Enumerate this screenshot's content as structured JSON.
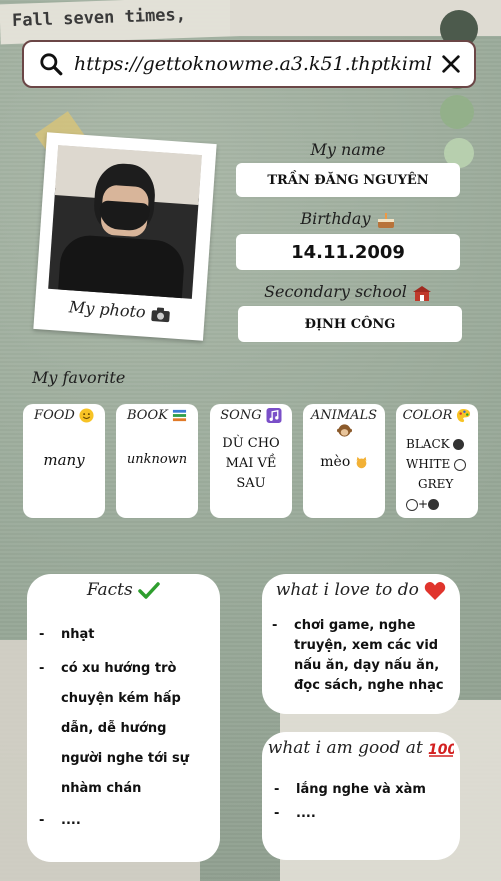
{
  "header": {
    "deco_text": "Fall seven times,",
    "url": "https://gettoknowme.a3.k51.thptkimlien"
  },
  "profile": {
    "photo_caption": "My photo",
    "name_label": "My name",
    "name_value": "TRẦN ĐĂNG NGUYÊN",
    "birthday_label": "Birthday",
    "birthday_value": "14.11.2009",
    "school_label": "Secondary school",
    "school_value": "ĐỊNH CÔNG"
  },
  "favorites": {
    "title": "My favorite",
    "cards": [
      {
        "head": "FOOD",
        "icon": "smile-icon",
        "value": "many"
      },
      {
        "head": "BOOK",
        "icon": "books-icon",
        "value": "unknown"
      },
      {
        "head": "SONG",
        "icon": "music-icon",
        "value": "DÙ CHO MAI VỀ SAU"
      },
      {
        "head": "ANIMALS",
        "icon": "monkey-icon",
        "value": "mèo"
      },
      {
        "head": "COLOR",
        "icon": "palette-icon",
        "lines": [
          "BLACK",
          "WHITE",
          "GREY",
          "+"
        ]
      }
    ]
  },
  "facts": {
    "title": "Facts",
    "items": [
      "nhạt",
      "có xu hướng trò chuyện kém hấp dẫn, dễ hướng người nghe tới sự nhàm chán",
      "...."
    ]
  },
  "love": {
    "title": "what i love to do",
    "items": [
      "chơi game, nghe truyện, xem các vid nấu ăn, dạy nấu ăn, đọc sách, nghe nhạc"
    ]
  },
  "good": {
    "title": "what i am good at",
    "items": [
      "lắng nghe và xàm",
      "...."
    ]
  },
  "colors": {
    "background": "#9fae9f",
    "urlbar_border": "#6b4646",
    "check": "#2e9e2e",
    "heart": "#e0342c",
    "hundred": "#d32020"
  }
}
